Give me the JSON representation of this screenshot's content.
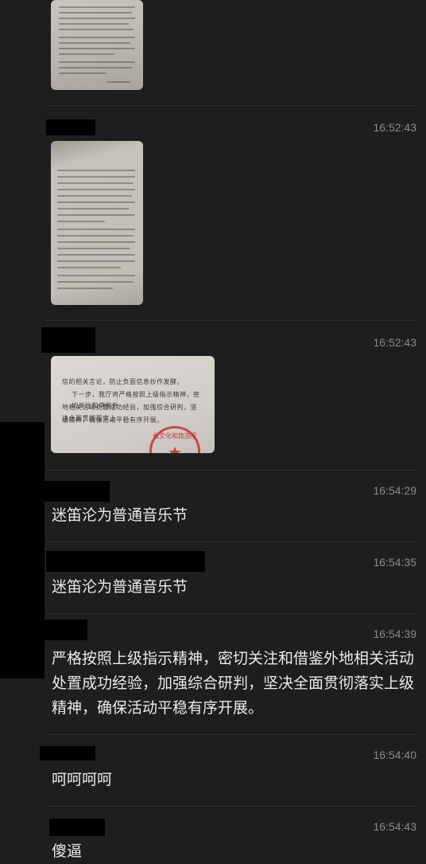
{
  "messages": [
    {
      "time": "",
      "type": "image",
      "image_desc": "document-photo-1"
    },
    {
      "time": "16:52:43",
      "type": "image",
      "image_desc": "document-photo-2"
    },
    {
      "time": "16:52:43",
      "type": "image",
      "image_desc": "document-photo-3"
    },
    {
      "time": "16:54:29",
      "type": "text",
      "text": "迷笛沦为普通音乐节"
    },
    {
      "time": "16:54:35",
      "type": "text",
      "text": "迷笛沦为普通音乐节"
    },
    {
      "time": "16:54:39",
      "type": "text",
      "text": "严格按照上级指示精神，密切关注和借鉴外地相关活动处置成功经验，加强综合研判，坚决全面贯彻落实上级精神，确保活动平稳有序开展。"
    },
    {
      "time": "16:54:40",
      "type": "text",
      "text": "呵呵呵呵"
    },
    {
      "time": "16:54:43",
      "type": "text",
      "text": "傻逼"
    }
  ],
  "photo3": {
    "line1": "信的相关言论，防止负面信息炒作发酵。",
    "line2": "下一步，我厅将严格按照上级指示精神，密切关注和借鉴外",
    "line3": "地相关活动处置成功经验，加强综合研判，坚决全面贯彻落实上",
    "line4": "级精神，确保活动平稳有序开展。",
    "seal_text": "省文化和旅游厅",
    "seal_star": "★"
  },
  "colors": {
    "background": "#1e1e1e",
    "divider": "#2e2e2e",
    "timestamp": "#8a8a8a",
    "text": "#e9e9e9",
    "redaction": "#000000",
    "seal": "#c81e1e"
  }
}
